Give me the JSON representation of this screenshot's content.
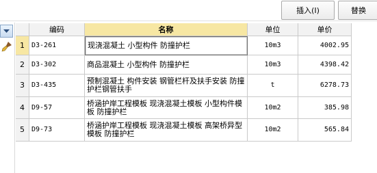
{
  "toolbar": {
    "insert_label": "插入(I)",
    "replace_label": "替换"
  },
  "left_panel": {
    "dropdown_icon": "chevron-down-icon",
    "brush_icon": "brush-icon"
  },
  "table": {
    "headers": {
      "index": "",
      "code": "编码",
      "name": "名称",
      "unit": "单位",
      "price": "单价"
    },
    "rows": [
      {
        "index": "1",
        "code": "D3-261",
        "name": "现浇混凝土 小型构件 防撞护栏",
        "unit": "10m3",
        "price": "4002.95"
      },
      {
        "index": "2",
        "code": "D3-302",
        "name": "商品混凝土 小型构件 防撞护栏",
        "unit": "10m3",
        "price": "4398.42"
      },
      {
        "index": "3",
        "code": "D3-435",
        "name": "预制混凝土 构件安装 钢管栏杆及扶手安装 防撞护栏钢管扶手",
        "unit": "t",
        "price": "6278.73"
      },
      {
        "index": "4",
        "code": "D9-57",
        "name": "桥涵护岸工程模板 现浇混凝土模板 小型构件模板 防撞护栏",
        "unit": "10m2",
        "price": "385.98"
      },
      {
        "index": "5",
        "code": "D9-73",
        "name": "桥涵护岸工程模板 现浇混凝土模板 高架桥异型模板 防撞护栏",
        "unit": "10m2",
        "price": "565.84"
      }
    ]
  }
}
